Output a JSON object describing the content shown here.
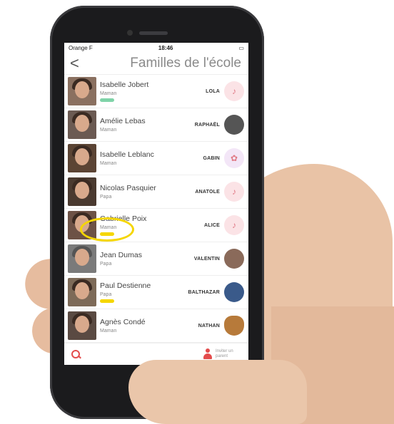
{
  "status": {
    "carrier": "Orange F",
    "time": "18:46"
  },
  "nav": {
    "back": "<",
    "title": "Familles de l'école"
  },
  "families": [
    {
      "name": "Isabelle Jobert",
      "role": "Maman",
      "tag": "#7fd3a8",
      "child": "LOLA",
      "child_avatar": "pacifier-icon"
    },
    {
      "name": "Amélie Lebas",
      "role": "Maman",
      "tag": "",
      "child": "RAPHAËL",
      "child_avatar": "child-photo"
    },
    {
      "name": "Isabelle Leblanc",
      "role": "Maman",
      "tag": "",
      "child": "GABIN",
      "child_avatar": "bear-toy-icon"
    },
    {
      "name": "Nicolas Pasquier",
      "role": "Papa",
      "tag": "",
      "child": "ANATOLE",
      "child_avatar": "pacifier-icon"
    },
    {
      "name": "Gabrielle Poix",
      "role": "Maman",
      "tag": "#f5d600",
      "child": "ALICE",
      "child_avatar": "pacifier-icon"
    },
    {
      "name": "Jean Dumas",
      "role": "Papa",
      "tag": "",
      "child": "VALENTIN",
      "child_avatar": "child-photo"
    },
    {
      "name": "Paul Destienne",
      "role": "Papa",
      "tag": "#f5d600",
      "child": "BALTHAZAR",
      "child_avatar": "child-photo"
    },
    {
      "name": "Agnès Condé",
      "role": "Maman",
      "tag": "",
      "child": "NATHAN",
      "child_avatar": "teddy-bear-icon"
    }
  ],
  "bottom": {
    "invite_label": "Inviter un parent"
  },
  "colors": {
    "accent": "#e34c4c",
    "highlight": "#f5d600"
  }
}
